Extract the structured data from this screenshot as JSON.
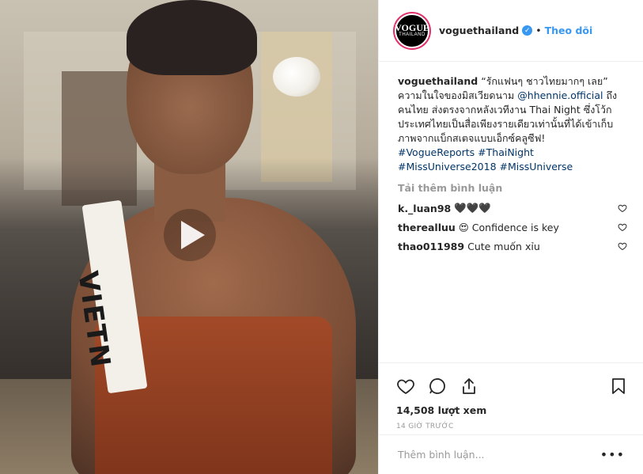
{
  "media": {
    "sash_text": "VIETN",
    "play_icon": "play-icon"
  },
  "header": {
    "avatar_line1": "VOGUE",
    "avatar_line2": "THAILAND",
    "username": "voguethailand",
    "verified_icon": "verified-badge-icon",
    "separator": "•",
    "follow_label": "Theo dõi"
  },
  "caption": {
    "username": "voguethailand",
    "text_before_link": "“รักแฟนๆ ชาวไทยมากๆ เลย” ความในใจของมิสเวียดนาม",
    "mention": "@hhennie.official",
    "text_after_link": "ถึงคนไทย ส่งตรงจากหลังเวทีงาน Thai Night ซึ่งโว้กประเทศไทยเป็นสื่อเพียงรายเดียวเท่านั้นที่ได้เข้าเก็บภาพจากแบ็กสเตจแบบเอ็กซ์คลูซีฟ!",
    "tags_line1": "#VogueReports #ThaiNight",
    "tags_line2": "#MissUniverse2018 #MissUniverse"
  },
  "load_more_label": "Tải thêm bình luận",
  "comments": [
    {
      "user": "k._luan98",
      "text": "🖤🖤🖤"
    },
    {
      "user": "therealluu",
      "text": "😍 Confidence is key"
    },
    {
      "user": "thao011989",
      "text": "Cute muốn xỉu"
    }
  ],
  "actions": {
    "views": "14,508 lượt xem",
    "time": "14 GIỜ TRƯỚC"
  },
  "add_comment": {
    "placeholder": "Thêm bình luận...",
    "more_label": "•••"
  }
}
